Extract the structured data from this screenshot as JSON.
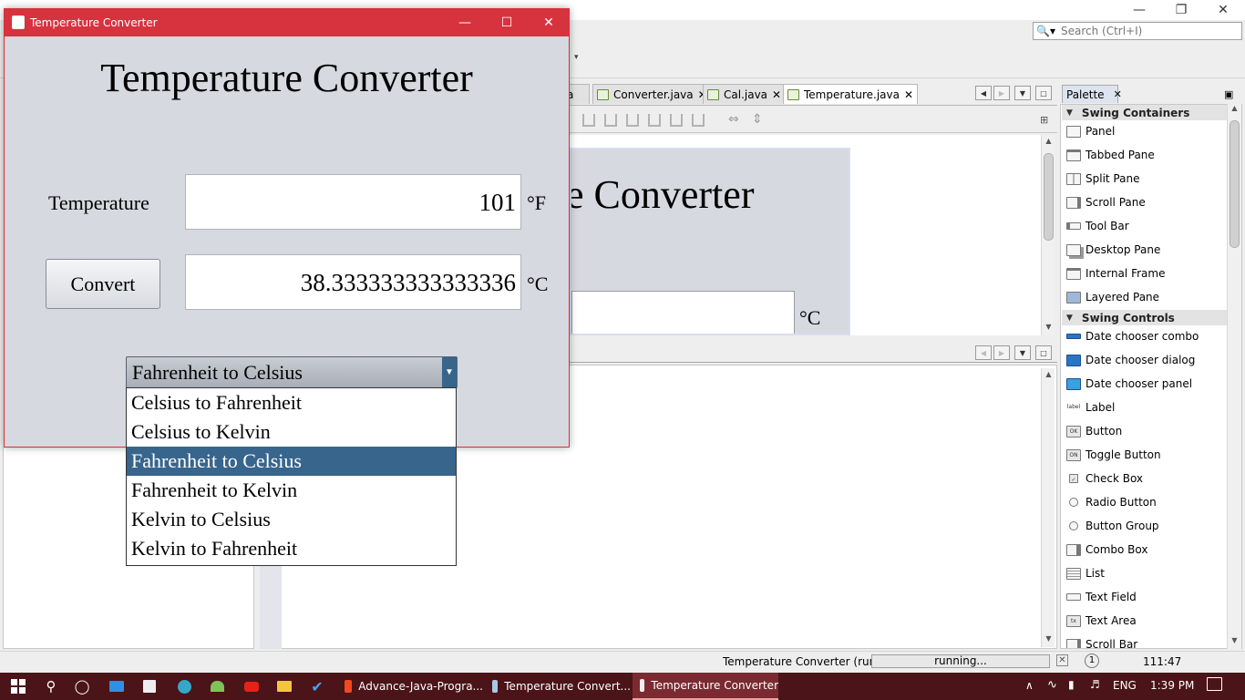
{
  "ide": {
    "search_placeholder": "Search (Ctrl+I)",
    "editor_tabs": [
      {
        "label": "a"
      },
      {
        "label": "Converter.java"
      },
      {
        "label": "Cal.java"
      },
      {
        "label": "Temperature.java"
      }
    ],
    "design_preview": {
      "heading_fragment": "e Converter",
      "unit_fragment": "°C"
    },
    "palette": {
      "tab_label": "Palette",
      "categories": [
        {
          "name": "Swing Containers",
          "items": [
            "Panel",
            "Tabbed Pane",
            "Split Pane",
            "Scroll Pane",
            "Tool Bar",
            "Desktop Pane",
            "Internal Frame",
            "Layered Pane"
          ]
        },
        {
          "name": "Swing Controls",
          "items": [
            "Date chooser combo",
            "Date chooser dialog",
            "Date chooser panel",
            "Label",
            "Button",
            "Toggle Button",
            "Check Box",
            "Radio Button",
            "Button Group",
            "Combo Box",
            "List",
            "Text Field",
            "Text Area",
            "Scroll Bar"
          ]
        }
      ]
    },
    "status": {
      "task": "Temperature Converter (run)",
      "progress_label": "running...",
      "progress_fraction": 1.0,
      "position": "111:47"
    }
  },
  "app_window": {
    "title": "Temperature Converter",
    "heading": "Temperature Converter",
    "temperature_label": "Temperature",
    "input_value": "101",
    "input_unit": "°F",
    "convert_label": "Convert",
    "output_value": "38.333333333333336",
    "output_unit": "°C",
    "combo_selected": "Fahrenheit to Celsius",
    "combo_options": [
      "Celsius to Fahrenheit",
      "Celsius to Kelvin",
      "Fahrenheit to Celsius",
      "Fahrenheit to Kelvin",
      "Kelvin to Celsius",
      "Kelvin to Fahrenheit"
    ],
    "combo_selected_index": 2
  },
  "taskbar": {
    "apps": [
      {
        "label": "Advance-Java-Progra..."
      },
      {
        "label": "Temperature Convert..."
      },
      {
        "label": "Temperature Converter"
      }
    ],
    "language": "ENG",
    "time": "1:39 PM"
  },
  "colors": {
    "app_title_bar": "#d6333f",
    "selection": "#38658c",
    "taskbar": "#4b1418"
  }
}
